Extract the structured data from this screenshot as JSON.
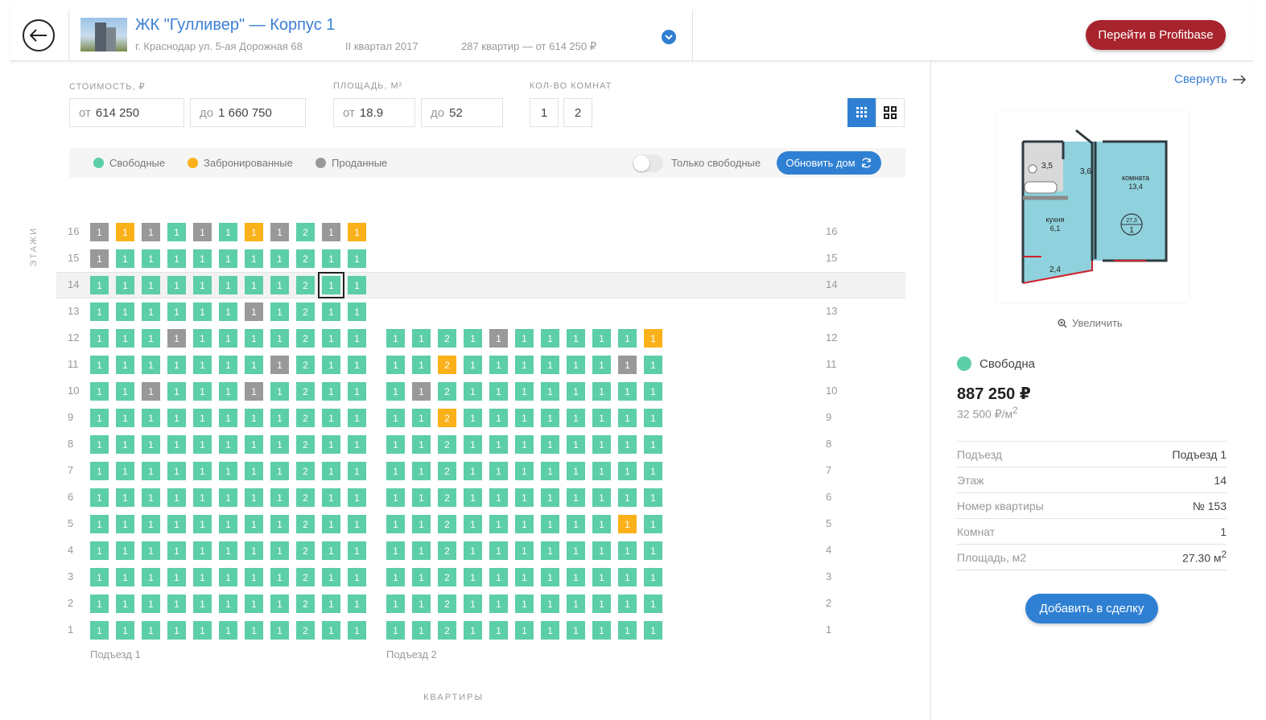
{
  "header": {
    "title": "ЖК \"Гулливер\" — Корпус 1",
    "address": "г. Краснодар ул. 5-ая Дорожная 68",
    "quarter": "II квартал 2017",
    "flats_summary": "287 квартир — от 614 250 ₽",
    "profitbase_btn": "Перейти в Profitbase"
  },
  "filters": {
    "price_label": "СТОИМОСТЬ, ₽",
    "price_from_prefix": "от",
    "price_from": "614 250",
    "price_to_prefix": "до",
    "price_to": "1 660 750",
    "area_label": "ПЛОЩАДЬ, М²",
    "area_from_prefix": "от",
    "area_from": "18.9",
    "area_to_prefix": "до",
    "area_to": "52",
    "rooms_label": "КОЛ-ВО КОМНАТ",
    "rooms": [
      "1",
      "2"
    ]
  },
  "legend": {
    "free": "Свободные",
    "booked": "Забронированные",
    "sold": "Проданные",
    "only_free": "Только свободные",
    "refresh": "Обновить дом"
  },
  "colors": {
    "free": "#5ccea8",
    "booked": "#fbb11a",
    "sold": "#999999",
    "accent": "#2f80d3",
    "brand_red": "#a8242d"
  },
  "grid": {
    "axis_title": "ЭТАЖИ",
    "flats_title": "КВАРТИРЫ",
    "floors": [
      "16",
      "15",
      "14",
      "13",
      "12",
      "11",
      "10",
      "9",
      "8",
      "7",
      "6",
      "5",
      "4",
      "3",
      "2",
      "1"
    ],
    "selected": {
      "entrance": 0,
      "floor": "14",
      "index": 9
    },
    "entrances": [
      {
        "name": "Подъезд 1",
        "rooms": [
          "1",
          "1",
          "1",
          "1",
          "1",
          "1",
          "1",
          "1",
          "2",
          "1",
          "1"
        ],
        "floor_status": {
          "16": [
            "s",
            "b",
            "s",
            "f",
            "s",
            "f",
            "b",
            "s",
            "f",
            "s",
            "b"
          ],
          "15": [
            "s",
            "f",
            "f",
            "f",
            "f",
            "f",
            "f",
            "f",
            "f",
            "f",
            "f"
          ],
          "14": [
            "f",
            "f",
            "f",
            "f",
            "f",
            "f",
            "f",
            "f",
            "f",
            "f",
            "f"
          ],
          "13": [
            "f",
            "f",
            "f",
            "f",
            "f",
            "f",
            "s",
            "f",
            "f",
            "f",
            "f"
          ],
          "12": [
            "f",
            "f",
            "f",
            "s",
            "f",
            "f",
            "f",
            "f",
            "f",
            "f",
            "f"
          ],
          "11": [
            "f",
            "f",
            "f",
            "f",
            "f",
            "f",
            "f",
            "s",
            "f",
            "f",
            "f"
          ],
          "10": [
            "f",
            "f",
            "s",
            "f",
            "f",
            "f",
            "s",
            "f",
            "f",
            "f",
            "f"
          ],
          "9": [
            "f",
            "f",
            "f",
            "f",
            "f",
            "f",
            "f",
            "f",
            "f",
            "f",
            "f"
          ],
          "8": [
            "f",
            "f",
            "f",
            "f",
            "f",
            "f",
            "f",
            "f",
            "f",
            "f",
            "f"
          ],
          "7": [
            "f",
            "f",
            "f",
            "f",
            "f",
            "f",
            "f",
            "f",
            "f",
            "f",
            "f"
          ],
          "6": [
            "f",
            "f",
            "f",
            "f",
            "f",
            "f",
            "f",
            "f",
            "f",
            "f",
            "f"
          ],
          "5": [
            "f",
            "f",
            "f",
            "f",
            "f",
            "f",
            "f",
            "f",
            "f",
            "f",
            "f"
          ],
          "4": [
            "f",
            "f",
            "f",
            "f",
            "f",
            "f",
            "f",
            "f",
            "f",
            "f",
            "f"
          ],
          "3": [
            "f",
            "f",
            "f",
            "f",
            "f",
            "f",
            "f",
            "f",
            "f",
            "f",
            "f"
          ],
          "2": [
            "f",
            "f",
            "f",
            "f",
            "f",
            "f",
            "f",
            "f",
            "f",
            "f",
            "f"
          ],
          "1": [
            "f",
            "f",
            "f",
            "f",
            "f",
            "f",
            "f",
            "f",
            "f",
            "f",
            "f"
          ]
        }
      },
      {
        "name": "Подъезд 2",
        "rooms": [
          "1",
          "1",
          "2",
          "1",
          "1",
          "1",
          "1",
          "1",
          "1",
          "1",
          "1"
        ],
        "floor_status": {
          "12": [
            "f",
            "f",
            "f",
            "f",
            "s",
            "f",
            "f",
            "f",
            "f",
            "f",
            "b"
          ],
          "11": [
            "f",
            "f",
            "b",
            "f",
            "f",
            "f",
            "f",
            "f",
            "f",
            "s",
            "f"
          ],
          "10": [
            "f",
            "s",
            "f",
            "f",
            "f",
            "f",
            "f",
            "f",
            "f",
            "f",
            "f"
          ],
          "9": [
            "f",
            "f",
            "b",
            "f",
            "f",
            "f",
            "f",
            "f",
            "f",
            "f",
            "f"
          ],
          "8": [
            "f",
            "f",
            "f",
            "f",
            "f",
            "f",
            "f",
            "f",
            "f",
            "f",
            "f"
          ],
          "7": [
            "f",
            "f",
            "f",
            "f",
            "f",
            "f",
            "f",
            "f",
            "f",
            "f",
            "f"
          ],
          "6": [
            "f",
            "f",
            "f",
            "f",
            "f",
            "f",
            "f",
            "f",
            "f",
            "f",
            "f"
          ],
          "5": [
            "f",
            "f",
            "f",
            "f",
            "f",
            "f",
            "f",
            "f",
            "f",
            "b",
            "f"
          ],
          "4": [
            "f",
            "f",
            "f",
            "f",
            "f",
            "f",
            "f",
            "f",
            "f",
            "f",
            "f"
          ],
          "3": [
            "f",
            "f",
            "f",
            "f",
            "f",
            "f",
            "f",
            "f",
            "f",
            "f",
            "f"
          ],
          "2": [
            "f",
            "f",
            "f",
            "f",
            "f",
            "f",
            "f",
            "f",
            "f",
            "f",
            "f"
          ],
          "1": [
            "f",
            "f",
            "f",
            "f",
            "f",
            "f",
            "f",
            "f",
            "f",
            "f",
            "f"
          ]
        }
      }
    ]
  },
  "side": {
    "collapse": "Свернуть",
    "zoom": "Увеличить",
    "status": "Свободна",
    "price": "887 250 ₽",
    "price_per_m_value": "32 500 ₽/м",
    "price_per_m_sup": "2",
    "props": [
      {
        "k": "Подъезд",
        "v": "Подъезд 1"
      },
      {
        "k": "Этаж",
        "v": "14"
      },
      {
        "k": "Номер квартиры",
        "v": "№ 153"
      },
      {
        "k": "Комнат",
        "v": "1"
      },
      {
        "k": "Площадь, м2",
        "v": "27.30 м",
        "sup": "2"
      }
    ],
    "add_btn": "Добавить в сделку",
    "plan": {
      "rooms": [
        {
          "label": "3,5"
        },
        {
          "label": "3,6"
        },
        {
          "label": "комната",
          "value": "13,4"
        },
        {
          "label": "кухня",
          "value": "6,1"
        },
        {
          "label": "2,4"
        }
      ],
      "badge_area": "27,3",
      "badge_rooms": "1"
    }
  }
}
